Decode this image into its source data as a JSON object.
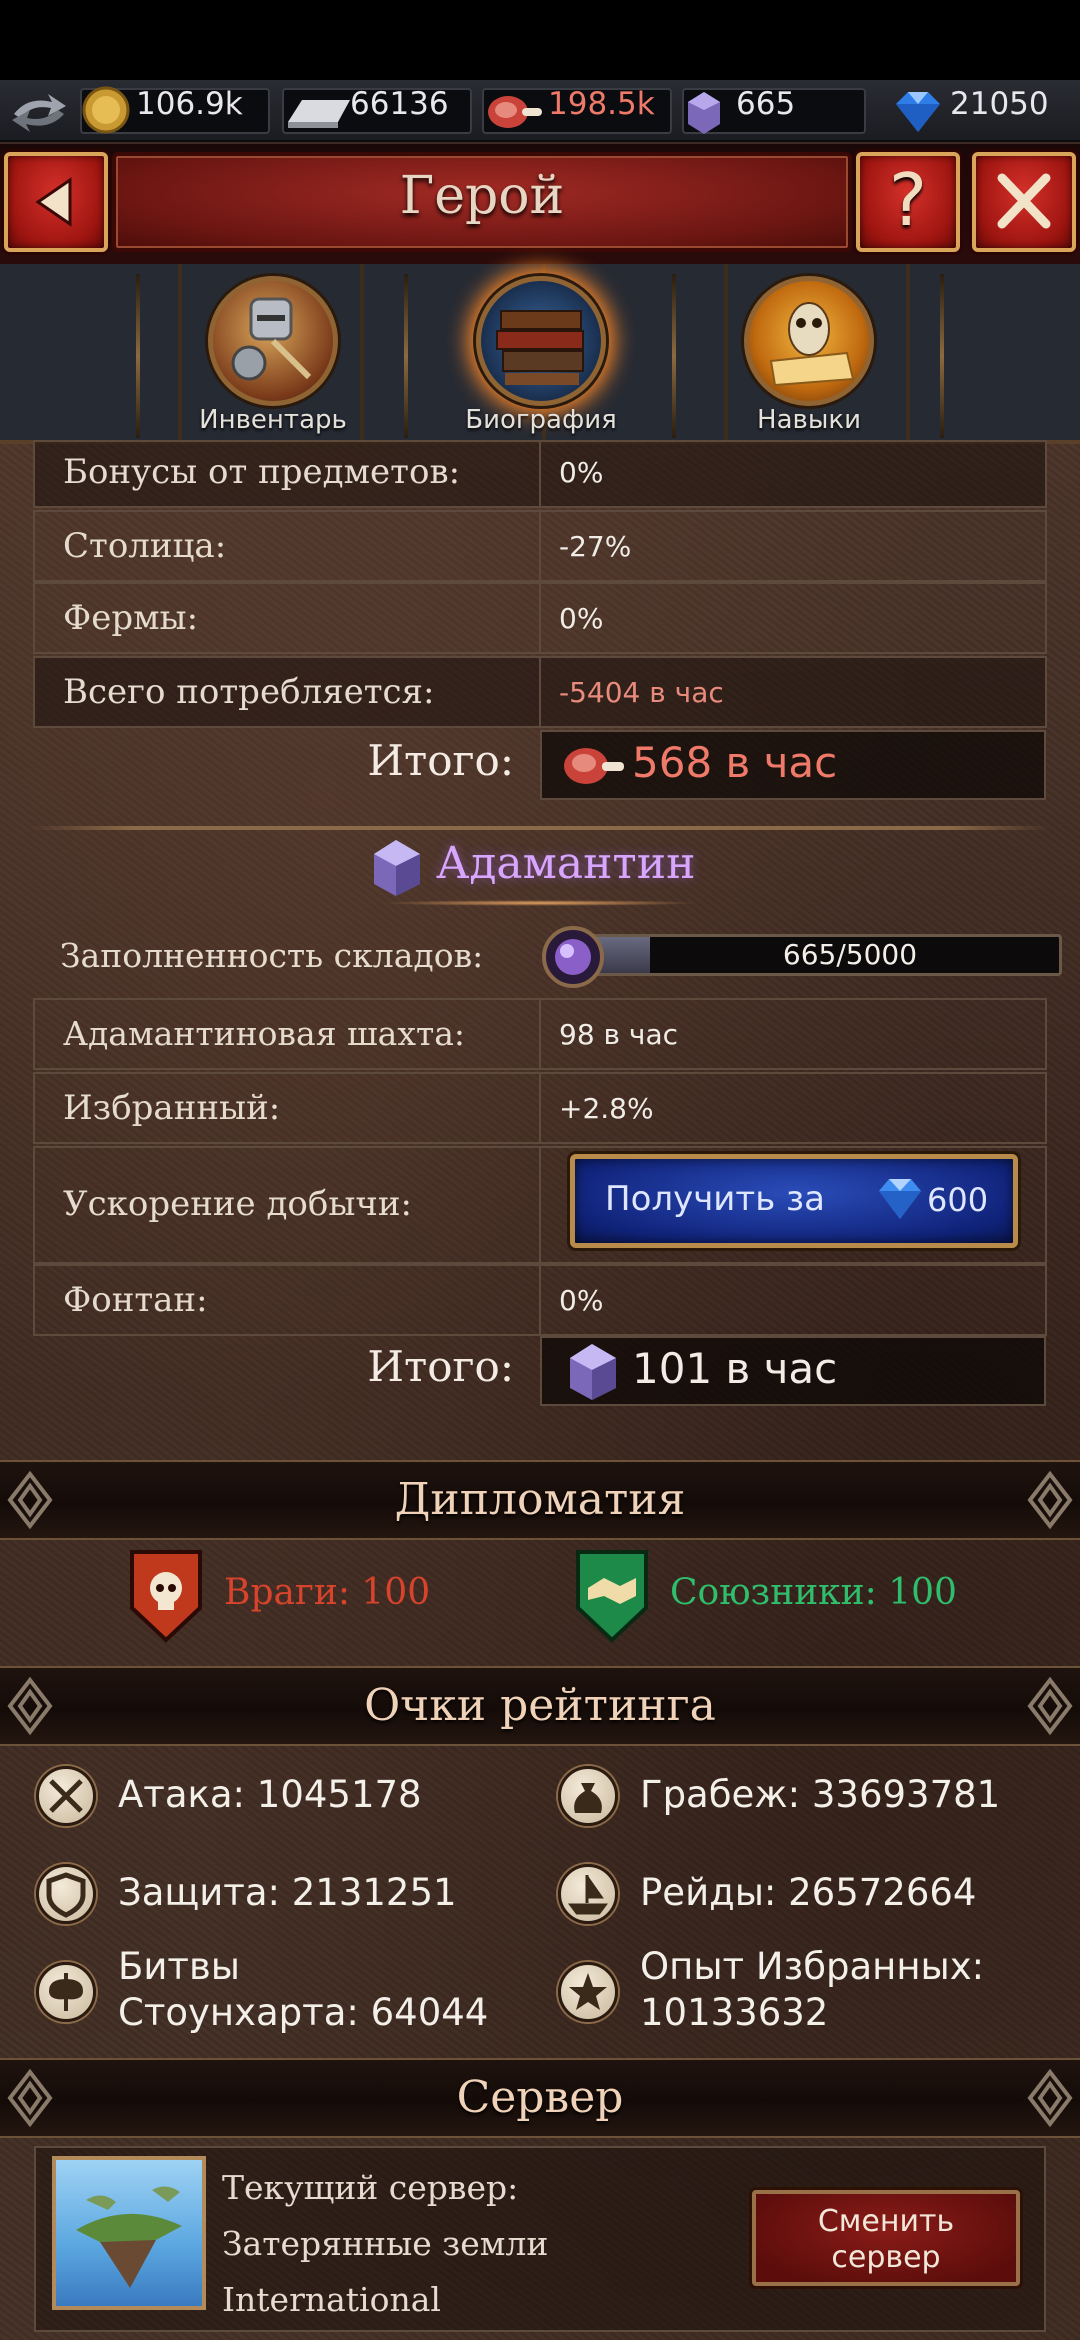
{
  "resources": {
    "gold": "106.9k",
    "iron": "66136",
    "food": "198.5k",
    "adamantine": "665",
    "gems": "21050"
  },
  "header": {
    "title": "Герой",
    "help_label": "?"
  },
  "tabs": [
    {
      "label": "Инвентарь",
      "icon": "armor-icon",
      "active": false
    },
    {
      "label": "Биография",
      "icon": "books-icon",
      "active": true
    },
    {
      "label": "Навыки",
      "icon": "owl-scroll-icon",
      "active": false
    }
  ],
  "food_table": {
    "rows": [
      {
        "label": "Бонусы от предметов:",
        "value": "0%"
      },
      {
        "label": "Столица:",
        "value": "-27%"
      },
      {
        "label": "Фермы:",
        "value": "0%"
      },
      {
        "label": "Всего потребляется:",
        "value": "-5404 в час"
      }
    ],
    "total_label": "Итого:",
    "total_value": "568 в час",
    "total_color": "#f07a6a"
  },
  "adamantine_section": {
    "title": "Адамантин",
    "title_color": "#d9a6ff",
    "storage_label": "Заполненность складов:",
    "storage_value": "665/5000",
    "storage_fill": 0.133,
    "rows": [
      {
        "label": "Адамантиновая шахта:",
        "value": "98 в час"
      },
      {
        "label": "Избранный:",
        "value": "+2.8%"
      },
      {
        "label": "Ускорение добычи:",
        "value": ""
      },
      {
        "label": "Фонтан:",
        "value": "0%"
      }
    ],
    "boost_button": {
      "label": "Получить за",
      "price": "600"
    },
    "total_label": "Итого:",
    "total_value": "101 в час"
  },
  "diplomacy": {
    "title": "Дипломатия",
    "enemies": "Враги: 100",
    "enemies_color": "#d8432c",
    "allies": "Союзники: 100",
    "allies_color": "#2fbf6c"
  },
  "rating": {
    "title": "Очки рейтинга",
    "items": [
      {
        "icon": "crossed-swords-icon",
        "text": "Атака: 1045178"
      },
      {
        "icon": "loot-bag-icon",
        "text": "Грабеж: 33693781"
      },
      {
        "icon": "shield-icon",
        "text": "Защита: 2131251"
      },
      {
        "icon": "ship-icon",
        "text": "Рейды: 26572664"
      },
      {
        "icon": "battle-axe-icon",
        "text_line1": "Битвы",
        "text_line2": "Стоунхарта: 64044"
      },
      {
        "icon": "star-icon",
        "text_line1": "Опыт Избранных:",
        "text_line2": "10133632"
      }
    ]
  },
  "server": {
    "title": "Сервер",
    "current_label": "Текущий сервер:",
    "name_line1": "Затерянные земли",
    "name_line2": "International",
    "change_line1": "Сменить",
    "change_line2": "сервер"
  }
}
